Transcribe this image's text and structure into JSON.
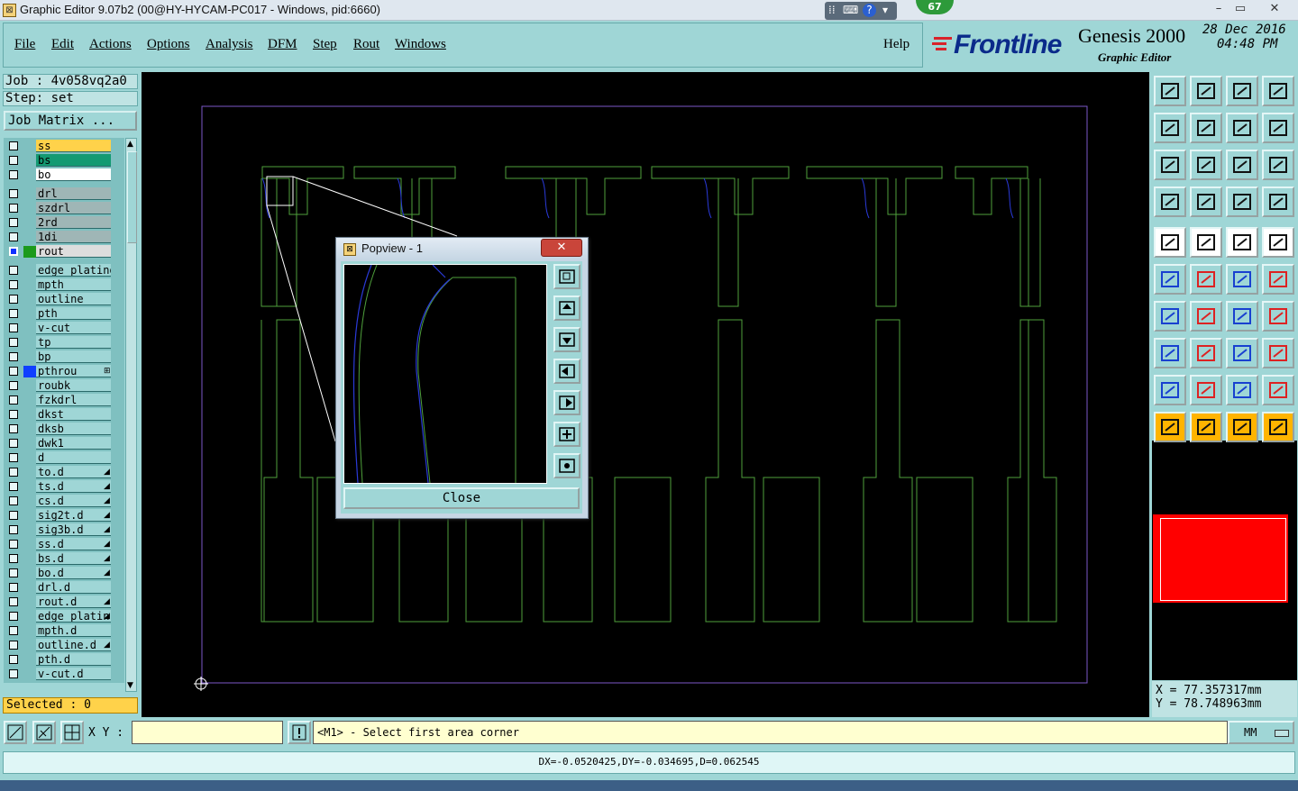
{
  "window": {
    "title": "Graphic Editor 9.07b2 (00@HY-HYCAM-PC017 - Windows, pid:6660)",
    "badge": "67",
    "controls": [
      "–",
      "▭",
      "✕"
    ]
  },
  "menu": {
    "items": [
      "File",
      "Edit",
      "Actions",
      "Options",
      "Analysis",
      "DFM",
      "Step",
      "Rout",
      "Windows"
    ],
    "help": "Help"
  },
  "brand": {
    "logo": "Frontline",
    "product": "Genesis 2000",
    "subtitle": "Graphic Editor",
    "date": "28 Dec 2016",
    "time": "04:48 PM"
  },
  "job": {
    "job_label": "Job : 4v058vq2a0",
    "step_label": "Step: set",
    "matrix_button": "Job Matrix ..."
  },
  "layers": [
    {
      "name": "ss",
      "bg": "#ffd24a"
    },
    {
      "name": "bs",
      "bg": "#139a72"
    },
    {
      "name": "bo",
      "bg": "#ffffff"
    },
    {
      "name": "drl",
      "bg": "#9fb6b6",
      "gap": true
    },
    {
      "name": "szdrl",
      "bg": "#9fb6b6"
    },
    {
      "name": "2rd",
      "bg": "#9fb6b6"
    },
    {
      "name": "1di",
      "bg": "#9fb6b6"
    },
    {
      "name": "rout",
      "bg": "#dddddd",
      "swatch": "#1c9a1c",
      "checked": true
    },
    {
      "name": "edge_plating",
      "bg": "#9fd6d6",
      "gap": true
    },
    {
      "name": "mpth",
      "bg": "#9fd6d6"
    },
    {
      "name": "outline",
      "bg": "#9fd6d6"
    },
    {
      "name": "pth",
      "bg": "#9fd6d6"
    },
    {
      "name": "v-cut",
      "bg": "#9fd6d6"
    },
    {
      "name": "tp",
      "bg": "#9fd6d6"
    },
    {
      "name": "bp",
      "bg": "#9fd6d6"
    },
    {
      "name": "pthrou",
      "bg": "#9fd6d6",
      "swatch": "#1040ff",
      "mark": "⊞"
    },
    {
      "name": "roubk",
      "bg": "#9fd6d6"
    },
    {
      "name": "fzkdrl",
      "bg": "#9fd6d6"
    },
    {
      "name": "dkst",
      "bg": "#9fd6d6"
    },
    {
      "name": "dksb",
      "bg": "#9fd6d6"
    },
    {
      "name": "dwk1",
      "bg": "#9fd6d6"
    },
    {
      "name": "d",
      "bg": "#9fd6d6"
    },
    {
      "name": "to.d",
      "bg": "#9fd6d6",
      "mark": "◢"
    },
    {
      "name": "ts.d",
      "bg": "#9fd6d6",
      "mark": "◢"
    },
    {
      "name": "cs.d",
      "bg": "#9fd6d6",
      "mark": "◢"
    },
    {
      "name": "sig2t.d",
      "bg": "#9fd6d6",
      "mark": "◢"
    },
    {
      "name": "sig3b.d",
      "bg": "#9fd6d6",
      "mark": "◢"
    },
    {
      "name": "ss.d",
      "bg": "#9fd6d6",
      "mark": "◢"
    },
    {
      "name": "bs.d",
      "bg": "#9fd6d6",
      "mark": "◢"
    },
    {
      "name": "bo.d",
      "bg": "#9fd6d6",
      "mark": "◢"
    },
    {
      "name": "drl.d",
      "bg": "#9fd6d6"
    },
    {
      "name": "rout.d",
      "bg": "#9fd6d6",
      "mark": "◢"
    },
    {
      "name": "edge_platin",
      "bg": "#9fd6d6",
      "mark": "◢"
    },
    {
      "name": "mpth.d",
      "bg": "#9fd6d6"
    },
    {
      "name": "outline.d",
      "bg": "#9fd6d6",
      "mark": "◢"
    },
    {
      "name": "pth.d",
      "bg": "#9fd6d6"
    },
    {
      "name": "v-cut.d",
      "bg": "#9fd6d6"
    }
  ],
  "selected": "Selected : 0",
  "popview": {
    "title": "Popview - 1",
    "close_x": "✕",
    "close_button": "Close",
    "tools": [
      "zoom-window-icon",
      "pan-up-icon",
      "pan-down-icon",
      "pan-left-icon",
      "pan-right-icon",
      "zoom-fit-icon",
      "zoom-home-icon"
    ]
  },
  "coords": {
    "x": "X  =  77.357317mm",
    "y": "Y  =  78.748963mm"
  },
  "bottom": {
    "xy_label": "X Y :",
    "xy_value": "",
    "prompt": "<M1> - Select first area corner",
    "units": "MM",
    "status": "DX=-0.0520425,DY=-0.034695,D=0.062545"
  },
  "colors": {
    "panel": "#9fd6d6",
    "canvas": "#000000",
    "rout_lines": "#4fa03c",
    "profile": "#7b59c9",
    "overlay": "#ff0000"
  }
}
